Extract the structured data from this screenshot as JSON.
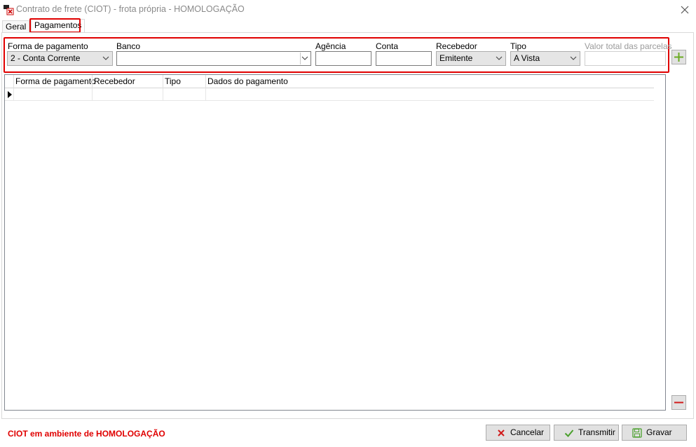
{
  "window": {
    "title": "Contrato de frete (CIOT) - frota própria - HOMOLOGAÇÃO"
  },
  "tabs": [
    {
      "label": "Geral",
      "active": false
    },
    {
      "label": "Pagamentos",
      "active": true
    }
  ],
  "form": {
    "forma_pagamento": {
      "label": "Forma de pagamento",
      "value": "2 - Conta Corrente"
    },
    "banco": {
      "label": "Banco",
      "value": ""
    },
    "agencia": {
      "label": "Agência",
      "value": ""
    },
    "conta": {
      "label": "Conta",
      "value": ""
    },
    "recebedor": {
      "label": "Recebedor",
      "value": "Emitente"
    },
    "tipo": {
      "label": "Tipo",
      "value": "A Vista"
    },
    "valor_total": {
      "label": "Valor total das parcelas",
      "value": ""
    }
  },
  "grid": {
    "columns": [
      "Forma de pagamento",
      "Recebedor",
      "Tipo",
      "Dados do pagamento"
    ],
    "rows": [
      [
        "",
        "",
        "",
        ""
      ]
    ]
  },
  "footer": {
    "status_message": "CIOT em ambiente de HOMOLOGAÇÃO",
    "cancel_label": "Cancelar",
    "transmit_label": "Transmitir",
    "save_label": "Gravar"
  },
  "colors": {
    "highlight": "#e00000",
    "add_icon": "#6aab22",
    "remove_icon": "#d11a1a",
    "cancel_icon": "#d11a1a",
    "ok_icon": "#4aa02c"
  },
  "icons": {
    "app": "truck-document-icon",
    "close": "close-icon",
    "add": "plus-icon",
    "remove": "minus-icon",
    "cancel": "x-icon",
    "transmit": "checkmark-icon",
    "save": "floppy-disk-icon"
  }
}
